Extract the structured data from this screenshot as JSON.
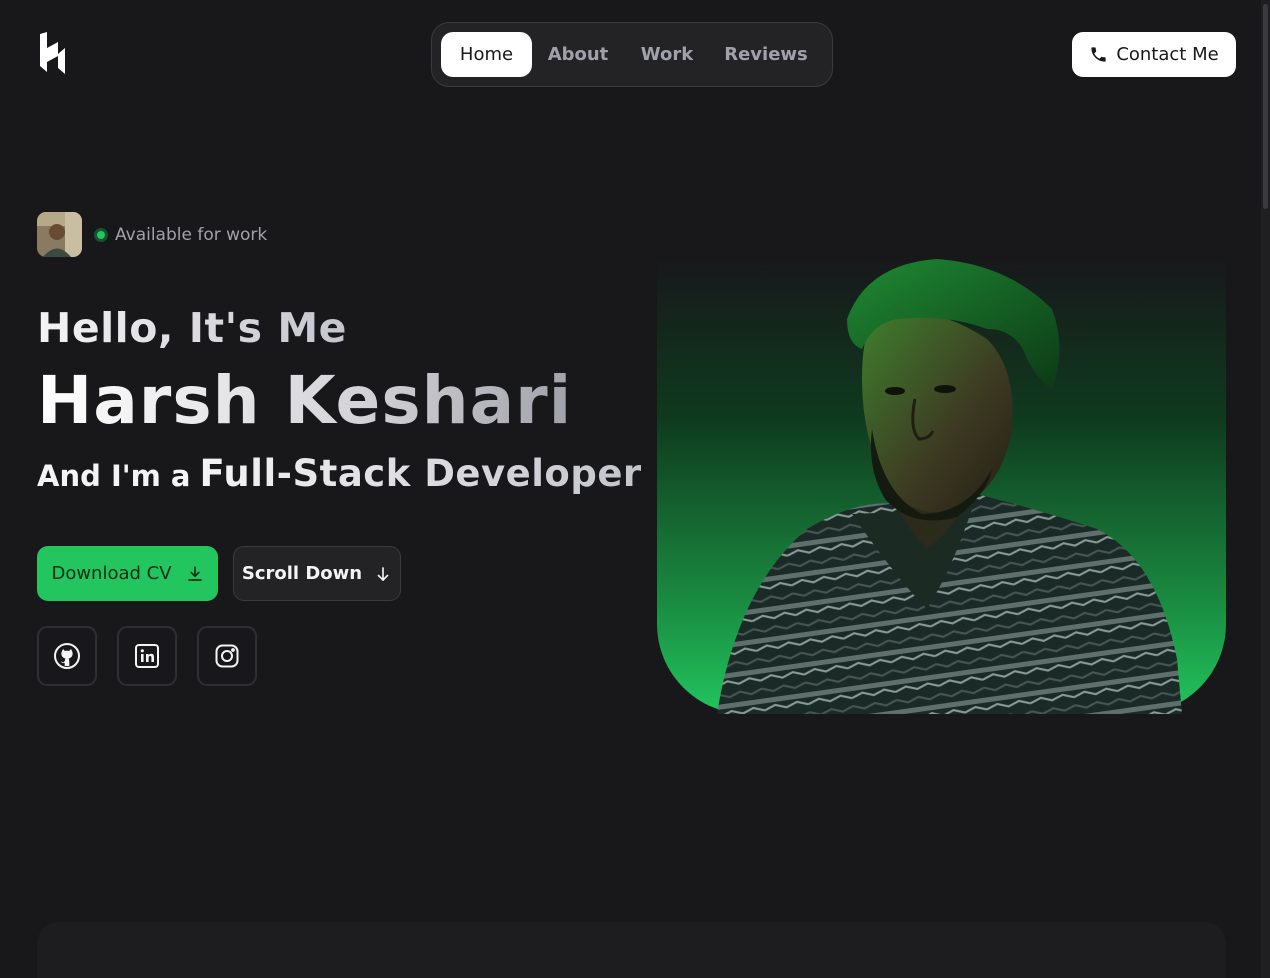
{
  "nav": {
    "items": [
      {
        "label": "Home",
        "active": true
      },
      {
        "label": "About",
        "active": false
      },
      {
        "label": "Work",
        "active": false
      },
      {
        "label": "Reviews",
        "active": false
      }
    ]
  },
  "header": {
    "logo_icon": "brand-logo-icon",
    "contact_label": "Contact Me",
    "contact_icon": "phone-icon"
  },
  "hero": {
    "status_text": "Available for work",
    "greeting": "Hello, It's Me",
    "name": "Harsh Keshari",
    "role_prefix": "And I'm a",
    "role_title": "Full-Stack Developer",
    "download_label": "Download CV",
    "download_icon": "download-icon",
    "scroll_label": "Scroll Down",
    "scroll_icon": "arrow-down-icon"
  },
  "socials": [
    {
      "name": "GitHub",
      "icon": "github-icon"
    },
    {
      "name": "LinkedIn",
      "icon": "linkedin-icon"
    },
    {
      "name": "Instagram",
      "icon": "instagram-icon"
    }
  ],
  "colors": {
    "background": "#18181b",
    "accent": "#22c55e",
    "surface": "#232326",
    "border": "#3a3a3f",
    "muted_text": "#a1a1aa"
  }
}
